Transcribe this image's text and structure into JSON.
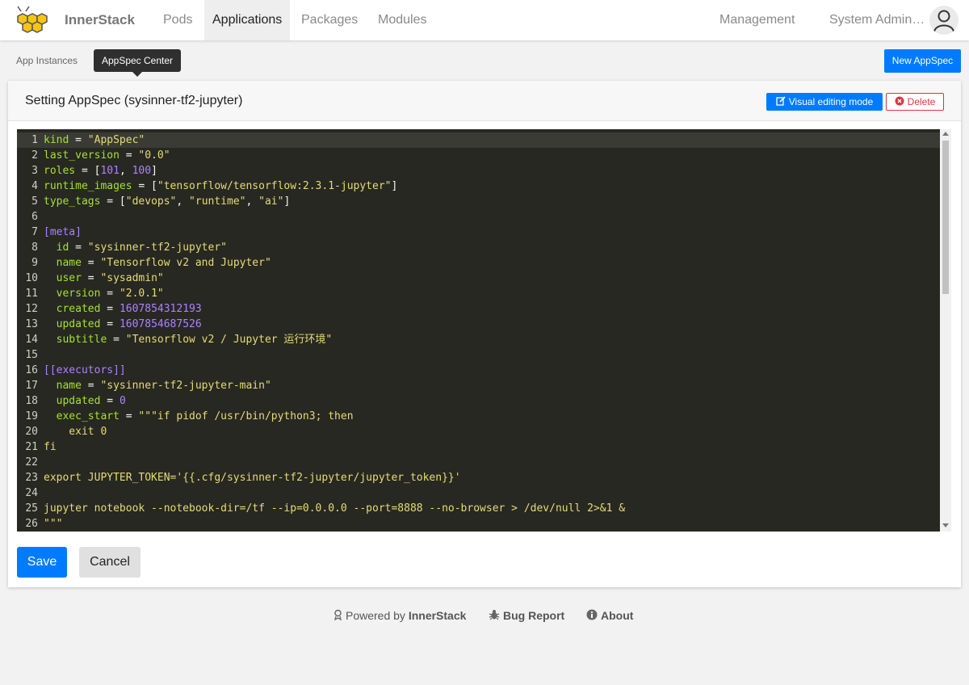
{
  "header": {
    "brand": "InnerStack",
    "nav": [
      "Pods",
      "Applications",
      "Packages",
      "Modules"
    ],
    "management": "Management",
    "user": "System Admin…"
  },
  "subnav": {
    "tabs": [
      "App Instances",
      "AppSpec Center"
    ],
    "new_button": "New AppSpec"
  },
  "card": {
    "title": "Setting AppSpec (sysinner-tf2-jupyter)",
    "visual_button": "Visual editing mode",
    "delete_button": "Delete",
    "save_button": "Save",
    "cancel_button": "Cancel"
  },
  "editor": {
    "lines": [
      [
        [
          "k",
          "kind"
        ],
        [
          "p",
          " = "
        ],
        [
          "s",
          "\"AppSpec\""
        ]
      ],
      [
        [
          "k",
          "last_version"
        ],
        [
          "p",
          " = "
        ],
        [
          "s",
          "\"0.0\""
        ]
      ],
      [
        [
          "k",
          "roles"
        ],
        [
          "p",
          " = ["
        ],
        [
          "n",
          "101"
        ],
        [
          "p",
          ", "
        ],
        [
          "n",
          "100"
        ],
        [
          "p",
          "]"
        ]
      ],
      [
        [
          "k",
          "runtime_images"
        ],
        [
          "p",
          " = ["
        ],
        [
          "s",
          "\"tensorflow/tensorflow:2.3.1-jupyter\""
        ],
        [
          "p",
          "]"
        ]
      ],
      [
        [
          "k",
          "type_tags"
        ],
        [
          "p",
          " = ["
        ],
        [
          "s",
          "\"devops\""
        ],
        [
          "p",
          ", "
        ],
        [
          "s",
          "\"runtime\""
        ],
        [
          "p",
          ", "
        ],
        [
          "s",
          "\"ai\""
        ],
        [
          "p",
          "]"
        ]
      ],
      [],
      [
        [
          "h",
          "[meta]"
        ]
      ],
      [
        [
          "p",
          "  "
        ],
        [
          "k",
          "id"
        ],
        [
          "p",
          " = "
        ],
        [
          "s",
          "\"sysinner-tf2-jupyter\""
        ]
      ],
      [
        [
          "p",
          "  "
        ],
        [
          "k",
          "name"
        ],
        [
          "p",
          " = "
        ],
        [
          "s",
          "\"Tensorflow v2 and Jupyter\""
        ]
      ],
      [
        [
          "p",
          "  "
        ],
        [
          "k",
          "user"
        ],
        [
          "p",
          " = "
        ],
        [
          "s",
          "\"sysadmin\""
        ]
      ],
      [
        [
          "p",
          "  "
        ],
        [
          "k",
          "version"
        ],
        [
          "p",
          " = "
        ],
        [
          "s",
          "\"2.0.1\""
        ]
      ],
      [
        [
          "p",
          "  "
        ],
        [
          "k",
          "created"
        ],
        [
          "p",
          " = "
        ],
        [
          "n",
          "1607854312193"
        ]
      ],
      [
        [
          "p",
          "  "
        ],
        [
          "k",
          "updated"
        ],
        [
          "p",
          " = "
        ],
        [
          "n",
          "1607854687526"
        ]
      ],
      [
        [
          "p",
          "  "
        ],
        [
          "k",
          "subtitle"
        ],
        [
          "p",
          " = "
        ],
        [
          "s",
          "\"Tensorflow v2 / Jupyter 运行环境\""
        ]
      ],
      [],
      [
        [
          "h",
          "[[executors]]"
        ]
      ],
      [
        [
          "p",
          "  "
        ],
        [
          "k",
          "name"
        ],
        [
          "p",
          " = "
        ],
        [
          "s",
          "\"sysinner-tf2-jupyter-main\""
        ]
      ],
      [
        [
          "p",
          "  "
        ],
        [
          "k",
          "updated"
        ],
        [
          "p",
          " = "
        ],
        [
          "n",
          "0"
        ]
      ],
      [
        [
          "p",
          "  "
        ],
        [
          "k",
          "exec_start"
        ],
        [
          "p",
          " = "
        ],
        [
          "s",
          "\"\"\"if pidof /usr/bin/python3; then"
        ]
      ],
      [
        [
          "s",
          "    exit 0"
        ]
      ],
      [
        [
          "s",
          "fi"
        ]
      ],
      [],
      [
        [
          "s",
          "export JUPYTER_TOKEN='{{.cfg/sysinner-tf2-jupyter/jupyter_token}}'"
        ]
      ],
      [],
      [
        [
          "s",
          "jupyter notebook --notebook-dir=/tf --ip=0.0.0.0 --port=8888 --no-browser > /dev/null 2>&1 &"
        ]
      ],
      [
        [
          "s",
          "\"\"\""
        ]
      ]
    ]
  },
  "footer": {
    "powered_prefix": "Powered by",
    "powered_brand": "InnerStack",
    "bug": "Bug Report",
    "about": "About"
  }
}
